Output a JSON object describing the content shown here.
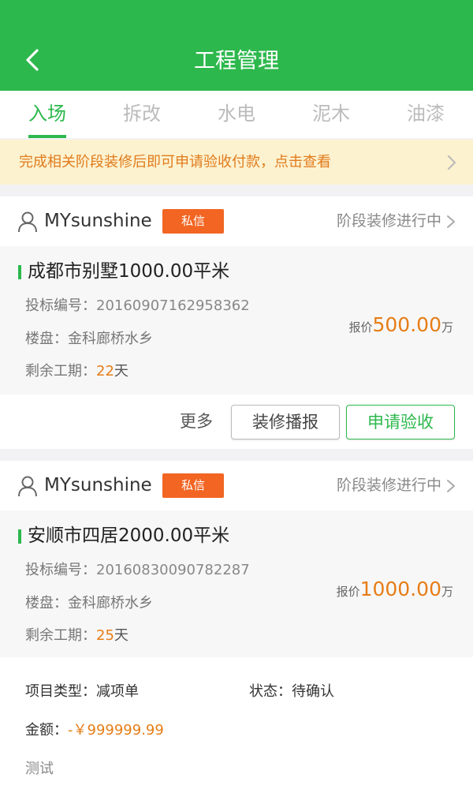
{
  "header": {
    "title": "工程管理",
    "back_icon": "chevron-left-icon",
    "background": "#2db84d"
  },
  "tabs": [
    {
      "label": "入场",
      "active": true
    },
    {
      "label": "拆改",
      "active": false
    },
    {
      "label": "水电",
      "active": false
    },
    {
      "label": "泥木",
      "active": false
    },
    {
      "label": "油漆",
      "active": false
    }
  ],
  "notice": {
    "text": "完成相关阶段装修后即可申请验收付款，点击查看",
    "icon": "chevron-right-icon"
  },
  "cards": [
    {
      "user_name": "MYsunshine",
      "pm_label": "私信",
      "stage_status": "阶段装修进行中",
      "project_title": "成都市别墅1000.00平米",
      "bid_label": "投标编号：",
      "bid_no": "20160907162958362",
      "estate_label": "楼盘：",
      "estate": "金科廊桥水乡",
      "remaining_label": "剩余工期：",
      "remaining_days": "22",
      "days_unit": "天",
      "price_label": "报价",
      "price": "500.00",
      "price_unit": "万",
      "more_label": "更多",
      "broadcast_label": "装修播报",
      "accept_label": "申请验收"
    },
    {
      "user_name": "MYsunshine",
      "pm_label": "私信",
      "stage_status": "阶段装修进行中",
      "project_title": "安顺市四居2000.00平米",
      "bid_label": "投标编号：",
      "bid_no": "20160830090782287",
      "estate_label": "楼盘：",
      "estate": "金科廊桥水乡",
      "remaining_label": "剩余工期：",
      "remaining_days": "25",
      "days_unit": "天",
      "price_label": "报价",
      "price": "1000.00",
      "price_unit": "万"
    }
  ],
  "detail": {
    "type_label": "项目类型：",
    "type_value": "减项单",
    "status_label": "状态：",
    "status_value": "待确认",
    "amount_label": "金额：",
    "amount_value": "-￥999999.99",
    "note": "测试"
  },
  "colors": {
    "accent": "#2db84d",
    "orange": "#e67d16",
    "pm_badge": "#f26522",
    "notice_bg": "#fdf2cf"
  }
}
